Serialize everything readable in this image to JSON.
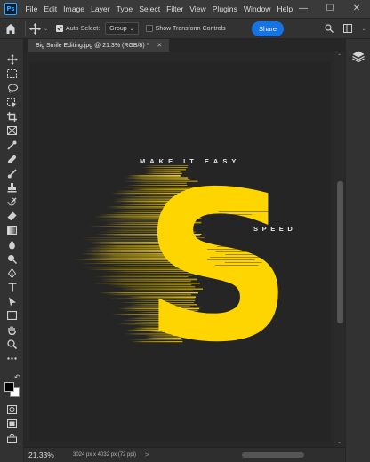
{
  "app": {
    "logo_text": "Ps"
  },
  "menu": [
    "File",
    "Edit",
    "Image",
    "Layer",
    "Type",
    "Select",
    "Filter",
    "View",
    "Plugins",
    "Window",
    "Help"
  ],
  "window_controls": {
    "minimize": "—",
    "maximize": "☐",
    "close": "✕"
  },
  "options_bar": {
    "auto_select_label": "Auto-Select:",
    "auto_select_value": "Group",
    "transform_label": "Show Transform Controls",
    "share_label": "Share"
  },
  "document": {
    "tab_title": "Big Smile Editing.jpg @ 21.3% (RGB/8) *"
  },
  "canvas": {
    "headline": "MAKE IT EASY",
    "tagline": "SPEED",
    "letter": "S",
    "colors": {
      "letter": "#ffd500",
      "background": "#252525",
      "text": "#e8e8e8"
    }
  },
  "status": {
    "zoom": "21.33%",
    "doc_info": "3024 px x 4032 px (72 ppi)",
    "arrow": ">"
  },
  "colors": {
    "accent": "#1473e6",
    "foreground_swatch": "#000000",
    "background_swatch": "#ffffff"
  }
}
